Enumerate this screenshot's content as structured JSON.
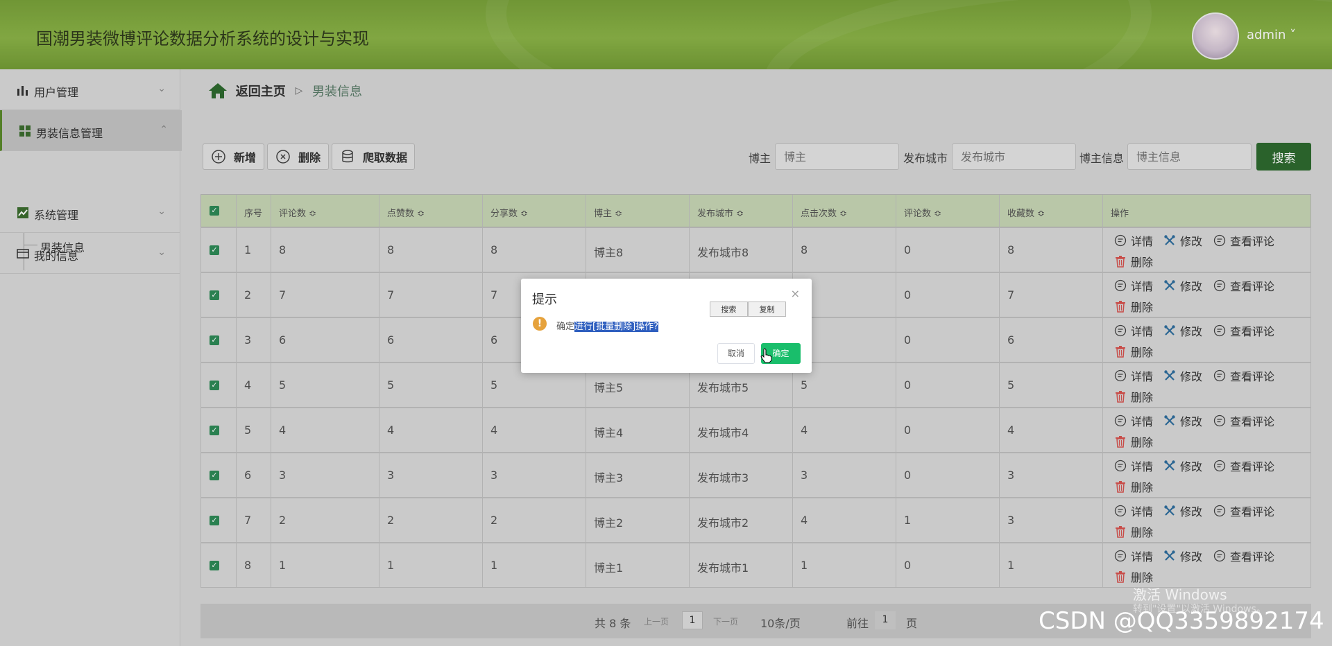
{
  "app": {
    "title": "国潮男装微博评论数据分析系统的设计与实现",
    "user": "admin ˅"
  },
  "sidebar": {
    "items": [
      {
        "label": "用户管理"
      },
      {
        "label": "男装信息管理"
      },
      {
        "label": "系统管理"
      },
      {
        "label": "我的信息"
      }
    ],
    "sub_item": "男装信息"
  },
  "breadcrumb": {
    "home": "返回主页",
    "separator": "▷",
    "current": "男装信息"
  },
  "toolbar": {
    "add": "新增",
    "delete": "删除",
    "crawl": "爬取数据"
  },
  "search": {
    "blogger_label": "博主",
    "blogger_placeholder": "博主",
    "city_label": "发布城市",
    "city_placeholder": "发布城市",
    "info_label": "博主信息",
    "info_placeholder": "博主信息",
    "button": "搜索"
  },
  "table": {
    "headers": [
      "序号",
      "评论数 ≎",
      "点赞数 ≎",
      "分享数 ≎",
      "博主 ≎",
      "发布城市 ≎",
      "点击次数 ≎",
      "评论数 ≎",
      "收藏数 ≎",
      "操作"
    ],
    "rows": [
      [
        "1",
        "8",
        "8",
        "8",
        "博主8",
        "发布城市8",
        "8",
        "0",
        "8"
      ],
      [
        "2",
        "7",
        "7",
        "7",
        "",
        "",
        "",
        "0",
        "7"
      ],
      [
        "3",
        "6",
        "6",
        "6",
        "",
        "",
        "",
        "0",
        "6"
      ],
      [
        "4",
        "5",
        "5",
        "5",
        "博主5",
        "发布城市5",
        "5",
        "0",
        "5"
      ],
      [
        "5",
        "4",
        "4",
        "4",
        "博主4",
        "发布城市4",
        "4",
        "0",
        "4"
      ],
      [
        "6",
        "3",
        "3",
        "3",
        "博主3",
        "发布城市3",
        "3",
        "0",
        "3"
      ],
      [
        "7",
        "2",
        "2",
        "2",
        "博主2",
        "发布城市2",
        "4",
        "1",
        "3"
      ],
      [
        "8",
        "1",
        "1",
        "1",
        "博主1",
        "发布城市1",
        "1",
        "0",
        "1"
      ]
    ],
    "ops": {
      "detail": "详情",
      "edit": "修改",
      "comments": "查看评论",
      "delete": "删除"
    }
  },
  "pager": {
    "total": "共 8 条",
    "prev": "上一页",
    "page": "1",
    "next": "下一页",
    "size": "10条/页",
    "goto": "前往",
    "goto_page": "1",
    "unit": "页"
  },
  "dialog": {
    "title": "提示",
    "close": "×",
    "msg_prefix": "确定",
    "msg_selected": "进行[批量删除]操作?",
    "mini_search": "搜索",
    "mini_copy": "复制",
    "cancel": "取消",
    "ok": "确定"
  },
  "watermark": {
    "line1": "激活 Windows",
    "line2": "转到\"设置\"以激活 Windows。",
    "csdn": "CSDN @QQ3359892174"
  },
  "colors": {
    "header": "#8cb548",
    "accent": "#2e6b2f",
    "ok": "#19be6b",
    "warn": "#e6a23c"
  }
}
